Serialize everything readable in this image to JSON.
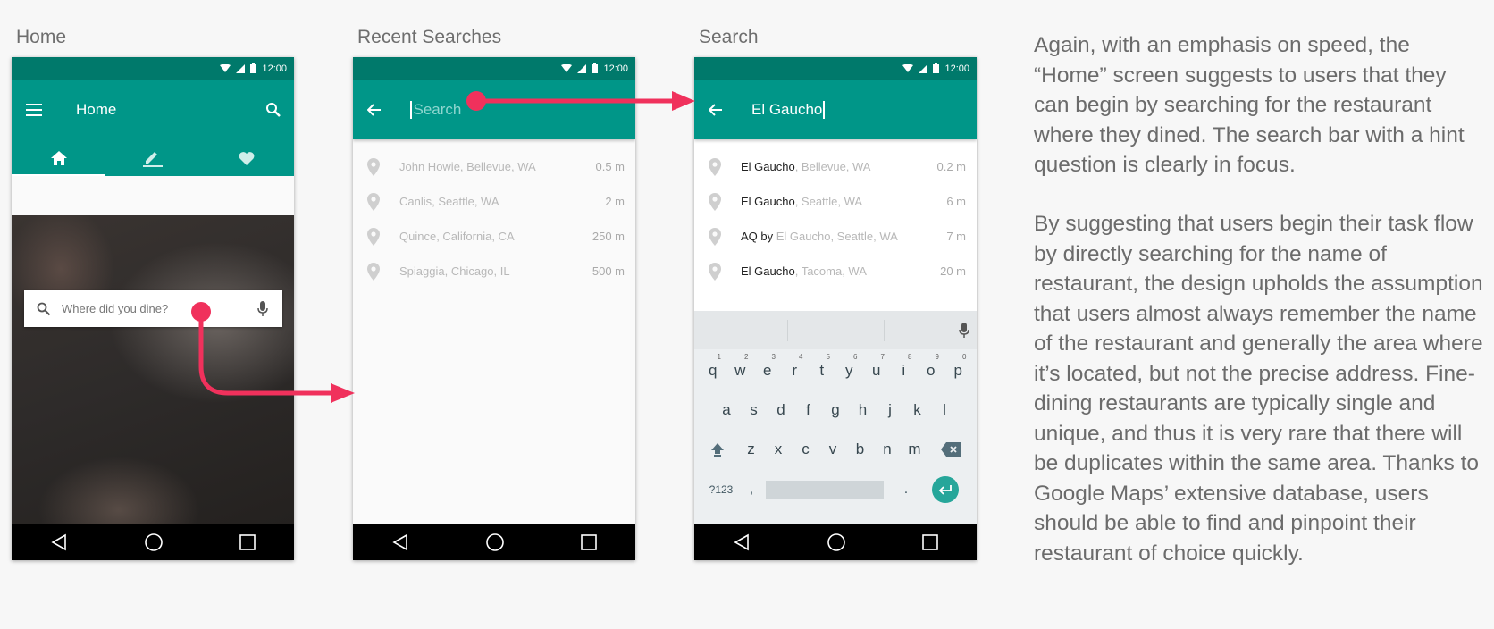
{
  "captions": {
    "home": "Home",
    "recent": "Recent Searches",
    "search": "Search"
  },
  "status": {
    "time": "12:00"
  },
  "home_screen": {
    "title": "Home",
    "search_placeholder": "Where did you dine?",
    "tabs": [
      "home-icon",
      "edit-icon",
      "favorite-icon"
    ]
  },
  "recent_screen": {
    "search_placeholder": "Search",
    "items": [
      {
        "name": "John Howie, Bellevue, WA",
        "distance": "0.5 m"
      },
      {
        "name": "Canlis, Seattle, WA",
        "distance": "2 m"
      },
      {
        "name": "Quince, California, CA",
        "distance": "250 m"
      },
      {
        "name": "Spiaggia, Chicago, IL",
        "distance": "500 m"
      }
    ]
  },
  "search_screen": {
    "query": "El Gaucho",
    "results": [
      {
        "match": "El Gaucho",
        "rest": ", Bellevue, WA",
        "distance": "0.2 m"
      },
      {
        "match": "El Gaucho",
        "rest": ", Seattle, WA",
        "distance": "6 m"
      },
      {
        "match": "AQ by ",
        "rest": "El Gaucho, Seattle, WA",
        "distance": "7 m"
      },
      {
        "match": "El Gaucho",
        "rest": ", Tacoma, WA",
        "distance": "20 m"
      }
    ]
  },
  "keyboard": {
    "row1": [
      "q",
      "w",
      "e",
      "r",
      "t",
      "y",
      "u",
      "i",
      "o",
      "p"
    ],
    "row1_digits": [
      "1",
      "2",
      "3",
      "4",
      "5",
      "6",
      "7",
      "8",
      "9",
      "0"
    ],
    "row2": [
      "a",
      "s",
      "d",
      "f",
      "g",
      "h",
      "j",
      "k",
      "l"
    ],
    "row3": [
      "z",
      "x",
      "c",
      "v",
      "b",
      "n",
      "m"
    ],
    "symbols_key": "?123",
    "comma": ",",
    "period": "."
  },
  "description": {
    "p1": "Again, with an emphasis on speed, the “Home” screen suggests to users that they can begin by searching for the restaurant where they dined. The search bar with a hint question is clearly in focus.",
    "p2": "By suggesting that users begin their task flow by directly searching for the name of restaurant, the design upholds the assumption that users almost always remember the name of the restaurant and generally the area where it’s located, but not the precise address. Fine-dining restaurants are typically single and unique, and thus it is very rare that there will be duplicates within the same area. Thanks to Google Maps’ extensive database, users should be able to find and pinpoint their restaurant of choice quickly."
  },
  "colors": {
    "accent": "#009688",
    "status": "#00796b",
    "arrow": "#f0315c"
  }
}
